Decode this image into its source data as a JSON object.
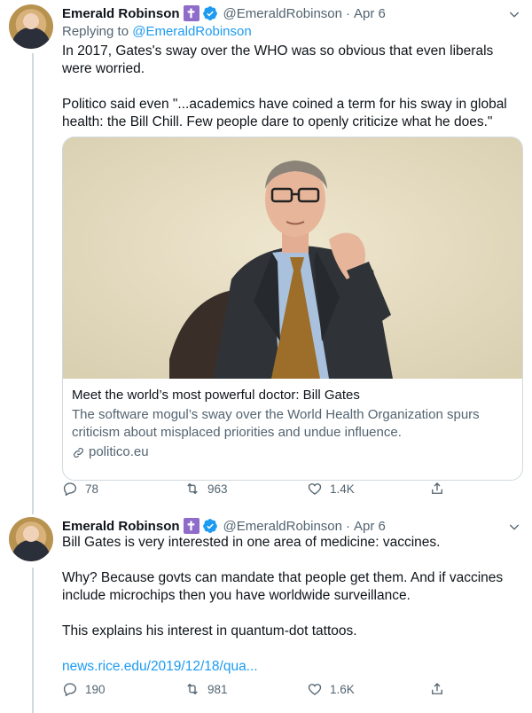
{
  "tweets": [
    {
      "name": "Emerald Robinson",
      "badge": "✝",
      "handle": "@EmeraldRobinson",
      "dot": "·",
      "date": "Apr 6",
      "replying_prefix": "Replying to ",
      "replying_handle": "@EmeraldRobinson",
      "text1": "In 2017, Gates's sway over the WHO was so obvious that even liberals were worried.",
      "text2": "Politico said even \"...academics have coined a term for his sway in global health: the Bill Chill. Few people dare to openly criticize what he does.\"",
      "card": {
        "title": "Meet the world’s most powerful doctor: Bill Gates",
        "description": "The software mogul’s sway over the World Health Organization spurs criticism about misplaced priorities and undue influence.",
        "domain": "politico.eu"
      },
      "replies": "78",
      "retweets": "963",
      "likes": "1.4K"
    },
    {
      "name": "Emerald Robinson",
      "badge": "✝",
      "handle": "@EmeraldRobinson",
      "dot": "·",
      "date": "Apr 6",
      "text1": "Bill Gates is very interested in one area of medicine: vaccines.",
      "text2": "Why? Because govts can mandate that people get them. And if vaccines include microchips then you have worldwide surveillance.",
      "text3": "This explains his interest in quantum-dot tattoos.",
      "link": "news.rice.edu/2019/12/18/qua...",
      "replies": "190",
      "retweets": "981",
      "likes": "1.6K"
    }
  ],
  "colors": {
    "accent": "#1d9bf0",
    "muted": "#536471",
    "badge": "#8e6cc9"
  }
}
